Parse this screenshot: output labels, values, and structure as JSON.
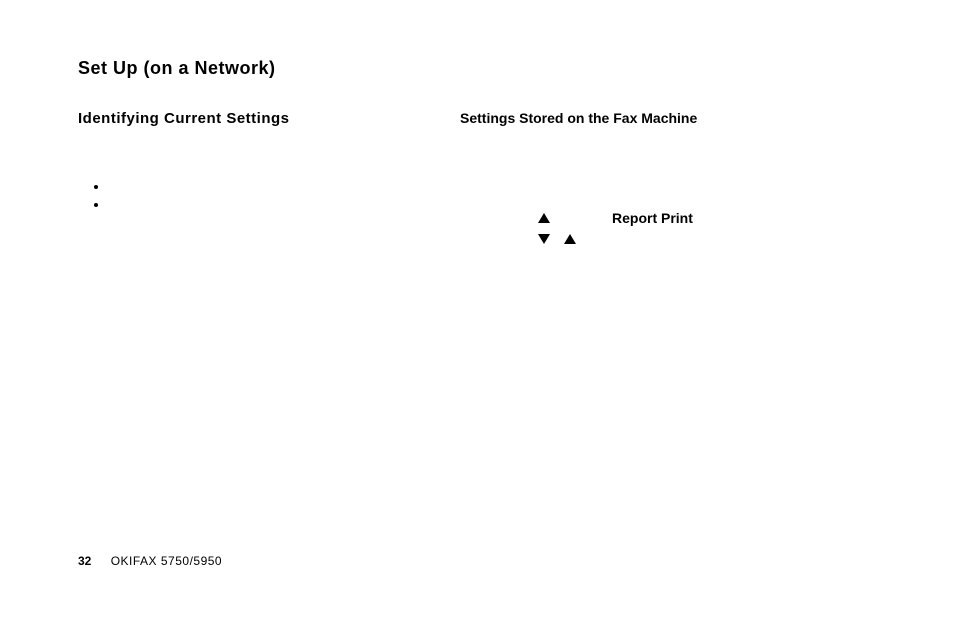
{
  "title": "Set Up (on a Network)",
  "left": {
    "subtitle": "Identifying Current Settings"
  },
  "right": {
    "subtitle": "Settings Stored on the Fax Machine",
    "report_label": "Report Print"
  },
  "footer": {
    "page": "32",
    "model": "OKIFAX 5750/5950"
  }
}
